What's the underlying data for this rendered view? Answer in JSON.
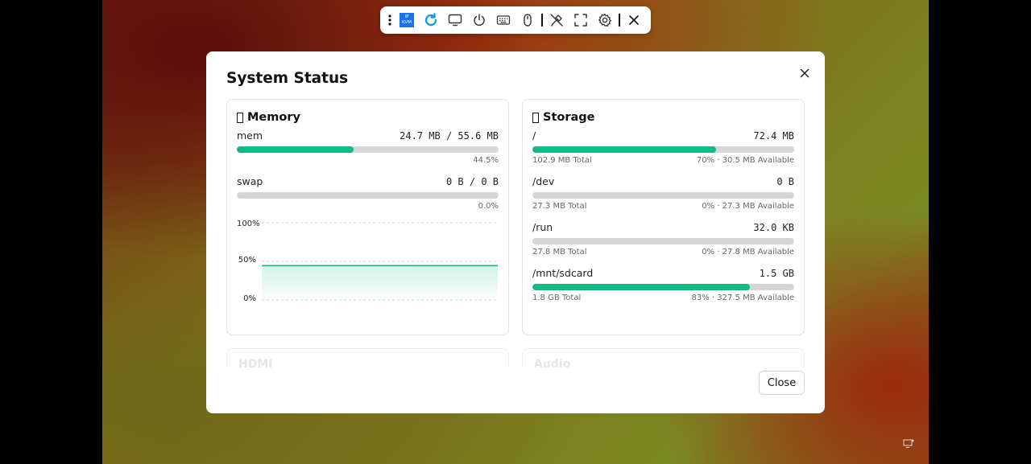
{
  "toolbar": {
    "logo_line1": "IP",
    "logo_line2": "KVM"
  },
  "dialog": {
    "title": "System Status",
    "close_label": "Close"
  },
  "memory": {
    "title": "Memory",
    "mem": {
      "label": "mem",
      "value": "24.7 MB / 55.6 MB",
      "percent": 44.5,
      "percent_text": "44.5%"
    },
    "swap": {
      "label": "swap",
      "value": "0 B / 0 B",
      "percent": 0,
      "percent_text": "0.0%"
    }
  },
  "storage": {
    "title": "Storage",
    "mounts": [
      {
        "name": "/",
        "used": "72.4 MB",
        "percent": 70,
        "total": "102.9 MB Total",
        "detail": "70% · 30.5 MB Available"
      },
      {
        "name": "/dev",
        "used": "0 B",
        "percent": 0,
        "total": "27.3 MB Total",
        "detail": "0% · 27.3 MB Available"
      },
      {
        "name": "/run",
        "used": "32.0 KB",
        "percent": 0,
        "total": "27.8 MB Total",
        "detail": "0% · 27.8 MB Available"
      },
      {
        "name": "/mnt/sdcard",
        "used": "1.5 GB",
        "percent": 83,
        "total": "1.8 GB Total",
        "detail": "83% · 327.5 MB Available"
      }
    ]
  },
  "ghost_cards": {
    "left": "HDMI",
    "right": "Audio"
  },
  "chart_data": {
    "type": "area",
    "title": "",
    "xlabel": "",
    "ylabel": "",
    "y_ticks": [
      "100%",
      "50%",
      "0%"
    ],
    "ylim": [
      0,
      100
    ],
    "series": [
      {
        "values": [
          44.5,
          44.5,
          44.5,
          44.5,
          44.5,
          44.5,
          44.5,
          44.5,
          44.5,
          44.5
        ]
      }
    ],
    "grid": true,
    "color": "#12b886"
  },
  "colors": {
    "accent": "#12b886",
    "track": "#d6d6d6"
  }
}
